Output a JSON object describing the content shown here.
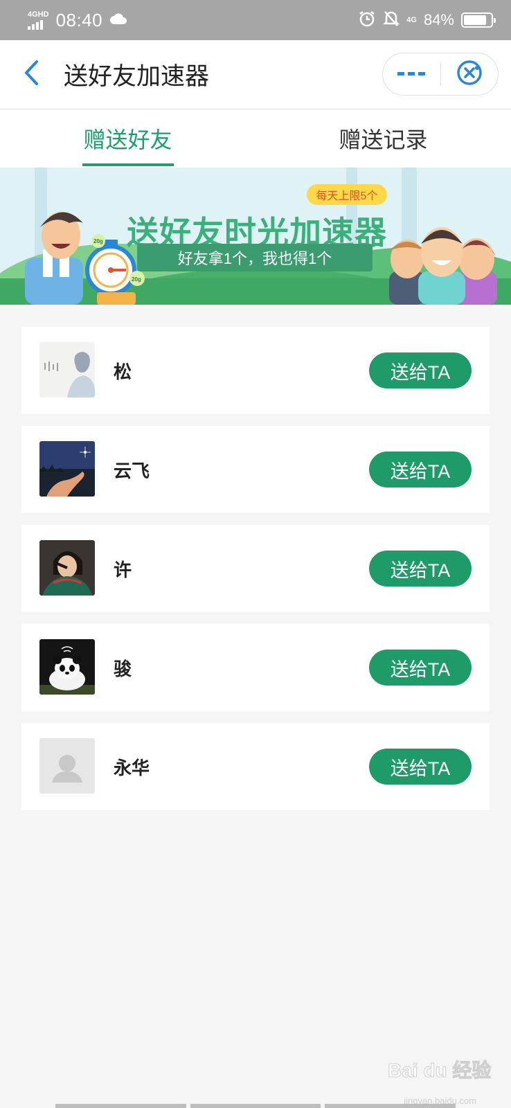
{
  "status_bar": {
    "network_type": "4GHD",
    "time": "08:40",
    "network_type_2": "4G",
    "battery_percent": "84%",
    "battery_level": 0.84
  },
  "header": {
    "title": "送好友加速器",
    "back_icon": "chevron-left-icon",
    "more_icon": "more-dots-icon",
    "close_icon": "close-circle-icon"
  },
  "tabs": [
    {
      "label": "赠送好友",
      "active": true
    },
    {
      "label": "赠送记录",
      "active": false
    }
  ],
  "banner": {
    "badge": "每天上限5个",
    "title": "送好友时光加速器",
    "subtitle": "好友拿1个，我也得1个",
    "stopwatch_tag_1": "20g",
    "stopwatch_tag_2": "20g"
  },
  "friends": [
    {
      "name": "松",
      "button": "送给TA",
      "avatar": "sketch-boy-avatar"
    },
    {
      "name": "云飞",
      "button": "送给TA",
      "avatar": "night-sky-hand-avatar"
    },
    {
      "name": "许",
      "button": "送给TA",
      "avatar": "girl-photo-avatar"
    },
    {
      "name": "骏",
      "button": "送给TA",
      "avatar": "panda-avatar"
    },
    {
      "name": "永华",
      "button": "送给TA",
      "avatar": "default-person-avatar"
    }
  ],
  "watermark": {
    "logo": "Bai du 经验",
    "url": "jingyan.baidu.com"
  },
  "colors": {
    "accent": "#1f9b6a",
    "status_bar": "#a6a6a6",
    "link_blue": "#2a86d6"
  }
}
